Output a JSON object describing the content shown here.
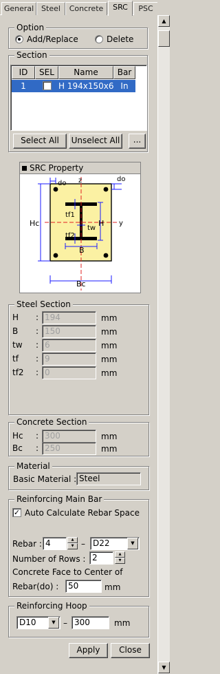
{
  "tabs": [
    {
      "label": "General",
      "active": false
    },
    {
      "label": "Steel",
      "active": false
    },
    {
      "label": "Concrete",
      "active": false
    },
    {
      "label": "SRC",
      "active": true
    },
    {
      "label": "PSC",
      "active": false
    }
  ],
  "option": {
    "title": "Option",
    "add_replace_label": "Add/Replace",
    "delete_label": "Delete",
    "selected": "Add/Replace"
  },
  "section": {
    "title": "Section",
    "columns": [
      "ID",
      "SEL",
      "Name",
      "Bar"
    ],
    "rows": [
      {
        "id": "1",
        "sel": true,
        "name": "H 194x150x6",
        "bar": "In"
      }
    ],
    "select_all_label": "Select All",
    "unselect_all_label": "Unselect All",
    "more_label": "..."
  },
  "property": {
    "title": "SRC Property",
    "diagram": {
      "do_top": "do",
      "do_right": "do",
      "z": "z",
      "y": "y",
      "Hc": "Hc",
      "H": "H",
      "tf1": "tf1",
      "tf2": "tf2",
      "tw": "tw",
      "B": "B",
      "Bc": "Bc"
    }
  },
  "steel_section": {
    "title": "Steel Section",
    "fields": [
      {
        "label": "H",
        "value": "194",
        "unit": "mm"
      },
      {
        "label": "B",
        "value": "150",
        "unit": "mm"
      },
      {
        "label": "tw",
        "value": "6",
        "unit": "mm"
      },
      {
        "label": "tf",
        "value": "9",
        "unit": "mm"
      },
      {
        "label": "tf2",
        "value": "0",
        "unit": "mm"
      }
    ]
  },
  "concrete_section": {
    "title": "Concrete Section",
    "fields": [
      {
        "label": "Hc",
        "value": "300",
        "unit": "mm"
      },
      {
        "label": "Bc",
        "value": "250",
        "unit": "mm"
      }
    ]
  },
  "material": {
    "title": "Material",
    "label": "Basic Material :",
    "value": "Steel"
  },
  "rebar_main": {
    "title": "Reinforcing Main Bar",
    "auto_calc_label": "Auto Calculate Rebar Space",
    "auto_calc_checked": true,
    "rebar_label": "Rebar :",
    "rebar_count": "4",
    "dash": "–",
    "rebar_size": "D22",
    "rows_label": "Number of Rows  :",
    "rows_value": "2",
    "face_label_1": "Concrete Face to Center of",
    "face_label_2": "Rebar(do)  :",
    "face_value": "50",
    "face_unit": "mm"
  },
  "rebar_hoop": {
    "title": "Reinforcing Hoop",
    "size": "D10",
    "dash": "–",
    "spacing": "300",
    "unit": "mm"
  },
  "buttons": {
    "apply": "Apply",
    "close": "Close"
  },
  "colors": {
    "window": "#d4d0c8",
    "selection": "#316ac5",
    "concrete_fill": "#fbf1a3",
    "steel": "#000000",
    "rebar": "#000000",
    "axis": "#e02020",
    "dim": "#1a1aff"
  }
}
